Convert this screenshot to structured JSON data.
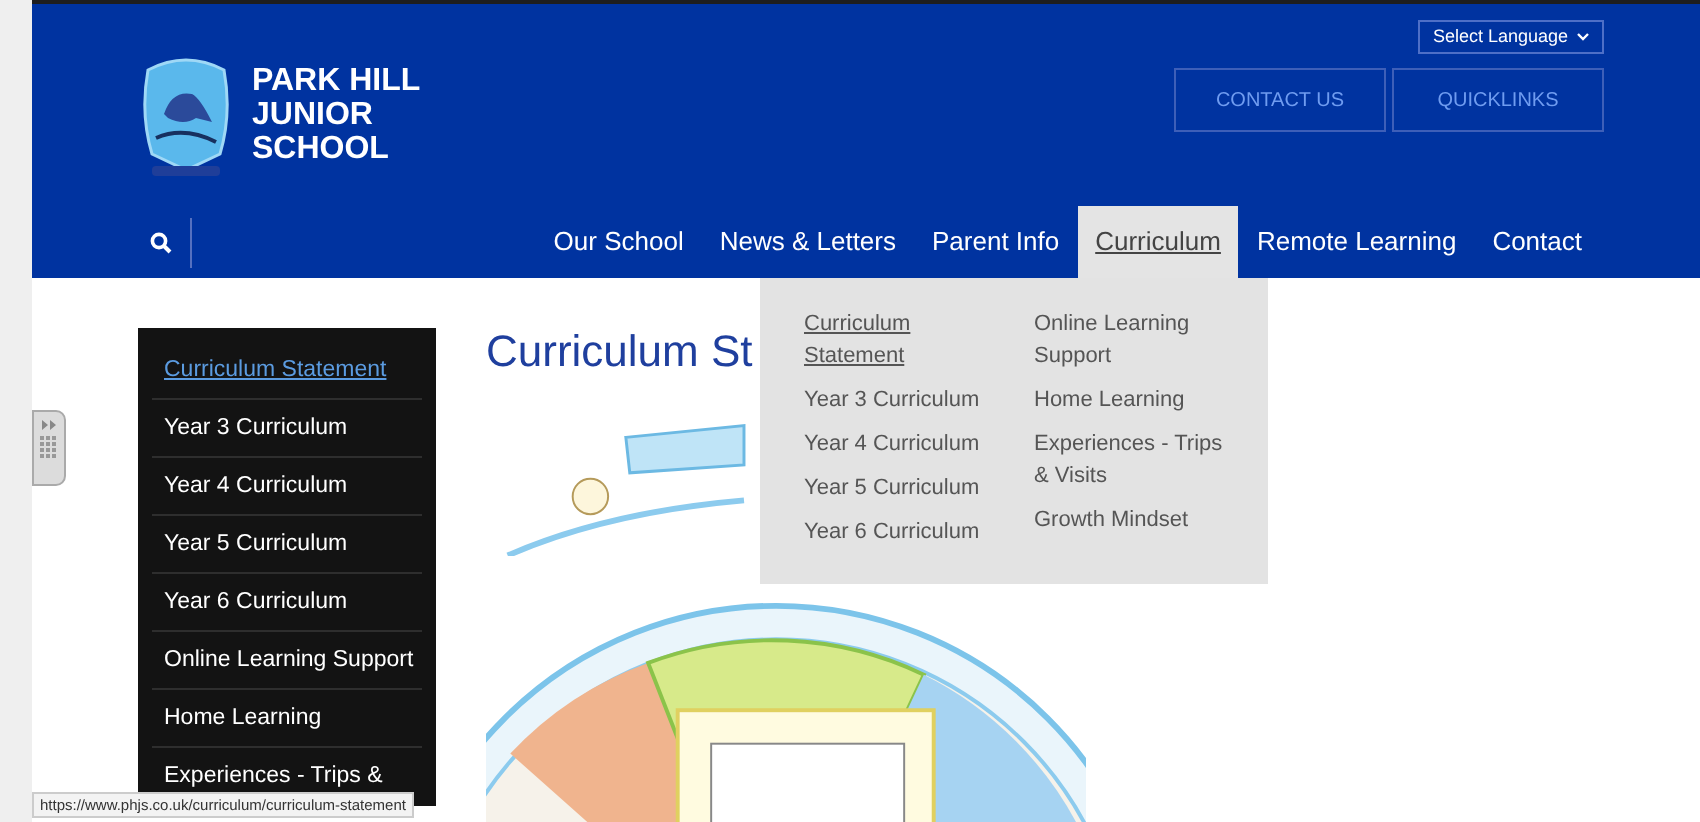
{
  "header": {
    "school_name": "PARK HILL JUNIOR SCHOOL",
    "language_select": "Select Language",
    "buttons": [
      "CONTACT US",
      "QUICKLINKS"
    ]
  },
  "nav": [
    {
      "label": "Our School",
      "selected": false
    },
    {
      "label": "News & Letters",
      "selected": false
    },
    {
      "label": "Parent Info",
      "selected": false
    },
    {
      "label": "Curriculum",
      "selected": true
    },
    {
      "label": "Remote Learning",
      "selected": false
    },
    {
      "label": "Contact",
      "selected": false
    }
  ],
  "dropdown": {
    "columns": [
      [
        {
          "label": "Curriculum Statement",
          "selected": true
        },
        {
          "label": "Year 3 Curriculum",
          "selected": false
        },
        {
          "label": "Year 4 Curriculum",
          "selected": false
        },
        {
          "label": "Year 5 Curriculum",
          "selected": false
        },
        {
          "label": "Year 6 Curriculum",
          "selected": false
        }
      ],
      [
        {
          "label": "Online Learning Support",
          "selected": false
        },
        {
          "label": "Home Learning",
          "selected": false
        },
        {
          "label": "Experiences - Trips & Visits",
          "selected": false
        },
        {
          "label": "Growth Mindset",
          "selected": false
        }
      ]
    ]
  },
  "sidebar": [
    {
      "label": "Curriculum Statement",
      "selected": true
    },
    {
      "label": "Year 3 Curriculum",
      "selected": false
    },
    {
      "label": "Year 4 Curriculum",
      "selected": false
    },
    {
      "label": "Year 5 Curriculum",
      "selected": false
    },
    {
      "label": "Year 6 Curriculum",
      "selected": false
    },
    {
      "label": "Online Learning Support",
      "selected": false
    },
    {
      "label": "Home Learning",
      "selected": false
    },
    {
      "label": "Experiences - Trips &",
      "selected": false
    }
  ],
  "page_title": "Curriculum St",
  "status_url": "https://www.phjs.co.uk/curriculum/curriculum-statement"
}
